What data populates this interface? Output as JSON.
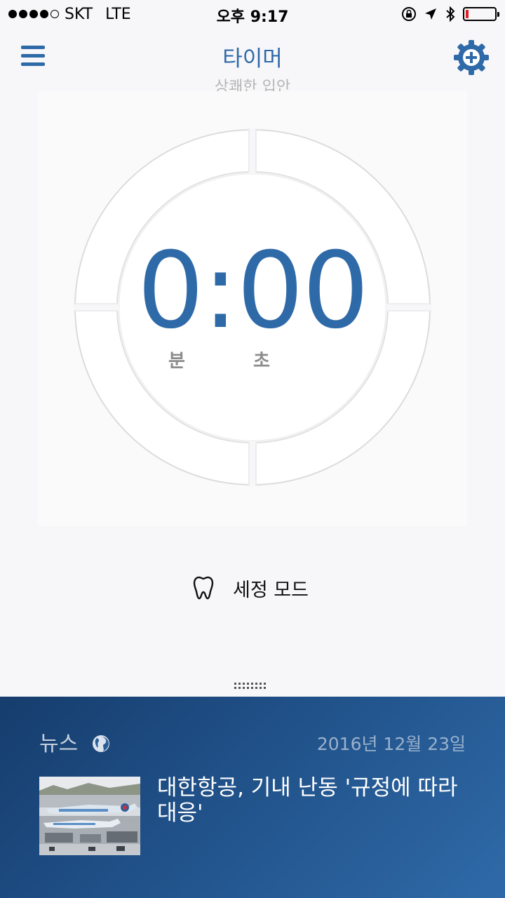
{
  "status_bar": {
    "carrier": "SKT",
    "network": "LTE",
    "time": "오후 9:17",
    "signal_bars": 4,
    "battery_level": 0.1
  },
  "header": {
    "title": "타이머",
    "subtitle": "상쾌한 입안",
    "menu_icon": "hamburger-menu-icon",
    "settings_icon": "gear-plus-icon"
  },
  "timer": {
    "display": "0:00",
    "minutes_label": "분",
    "seconds_label": "초"
  },
  "mode": {
    "icon": "tooth-icon",
    "label": "세정 모드"
  },
  "news": {
    "title": "뉴스",
    "date": "2016년 12월 23일",
    "headline": "대한항공, 기내 난동 '규정에 따라 대응'"
  },
  "colors": {
    "accent": "#2f6aa8",
    "news_bg": "#1f4f86",
    "battery_low": "#e02020"
  }
}
